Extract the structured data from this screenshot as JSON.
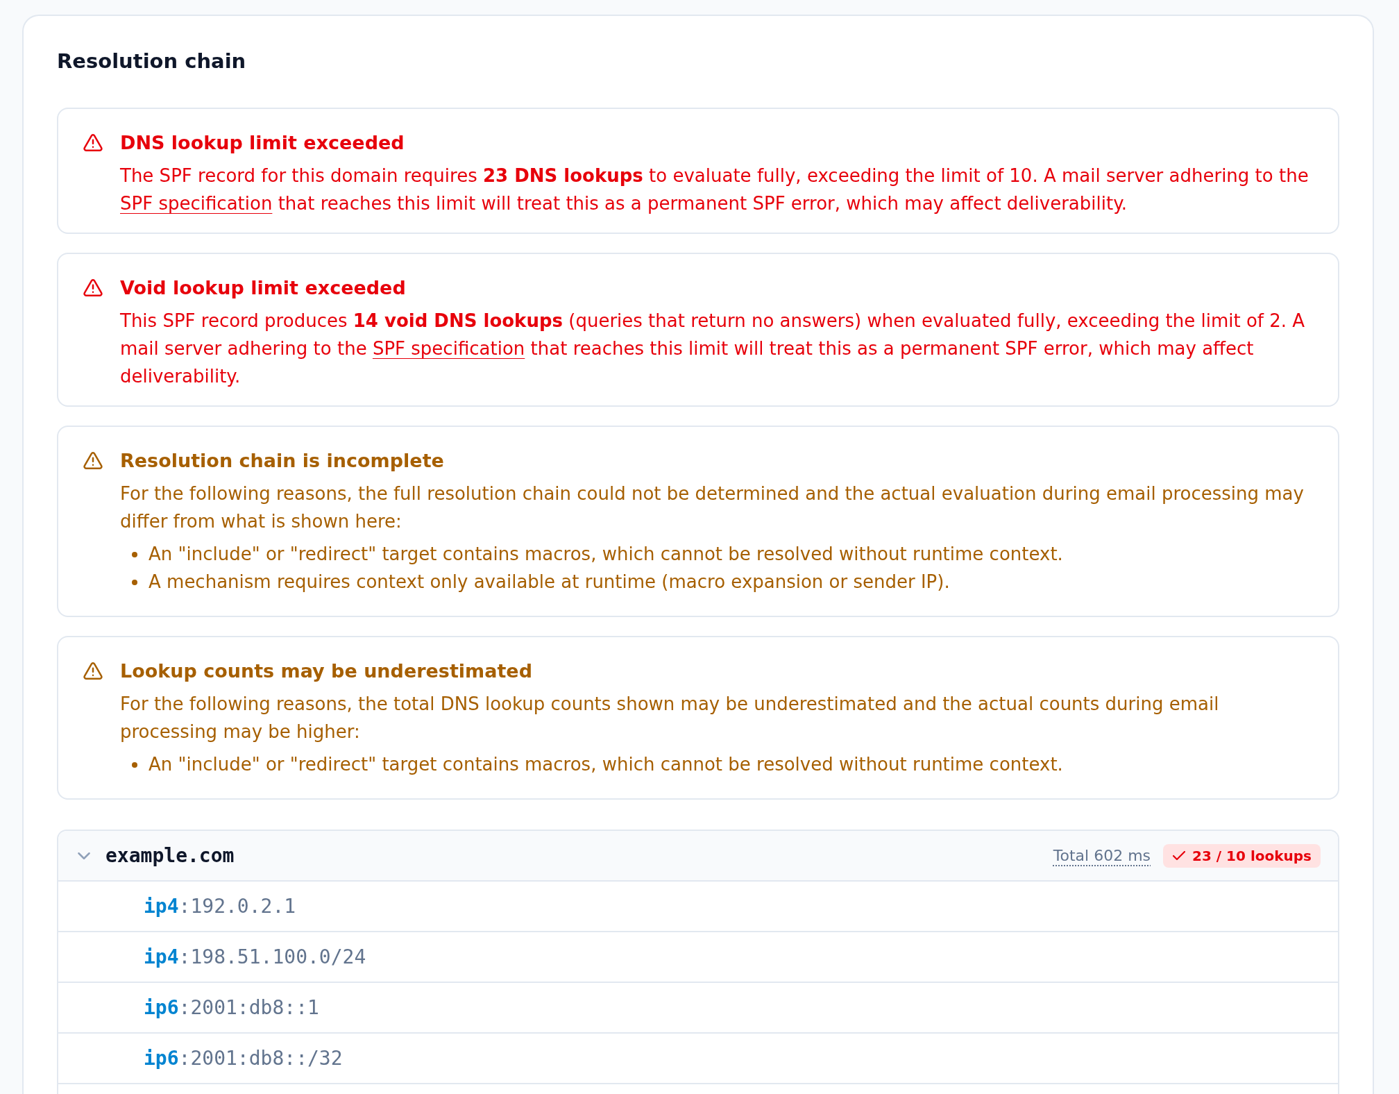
{
  "section": {
    "title": "Resolution chain"
  },
  "alerts": [
    {
      "kind": "error",
      "title": "DNS lookup limit exceeded",
      "message": [
        {
          "kind": "text",
          "text": "The SPF record for this domain requires **23 DNS lookups** to evaluate fully, exceeding the limit of 10. A mail server adhering to the "
        },
        {
          "kind": "link",
          "text": "SPF specification"
        },
        {
          "kind": "text",
          "text": " that reaches this limit will treat this as a permanent SPF error, which may affect deliverability."
        }
      ]
    },
    {
      "kind": "error",
      "title": "Void lookup limit exceeded",
      "message": [
        {
          "kind": "text",
          "text": "This SPF record produces **14 void DNS lookups** (queries that return no answers) when evaluated fully, exceeding the limit of 2. A mail server adhering to the "
        },
        {
          "kind": "link",
          "text": "SPF specification"
        },
        {
          "kind": "text",
          "text": " that reaches this limit will treat this as a permanent SPF error, which may affect deliverability."
        }
      ]
    },
    {
      "kind": "warning",
      "title": "Resolution chain is incomplete",
      "message": [
        {
          "kind": "text",
          "text": "For the following reasons, the full resolution chain could not be determined and the actual evaluation during email processing may differ from what is shown here:"
        }
      ],
      "reasons": [
        "An \"include\" or \"redirect\" target contains macros, which cannot be resolved without runtime context.",
        "A mechanism requires context only available at runtime (macro expansion or sender IP)."
      ]
    },
    {
      "kind": "warning",
      "title": "Lookup counts may be underestimated",
      "message": [
        {
          "kind": "text",
          "text": "For the following reasons, the total DNS lookup counts shown may be underestimated and the actual counts during email processing may be higher:"
        }
      ],
      "reasons": [
        "An \"include\" or \"redirect\" target contains macros, which cannot be resolved without runtime context."
      ]
    }
  ],
  "tree": {
    "domain": "example.com",
    "expanded": true,
    "total": "Total 602 ms",
    "lookups": {
      "text": "23 / 10 lookups",
      "over_limit": true
    },
    "children": [
      {
        "term": "**ip4**:192.0.2.1"
      },
      {
        "term": "**ip4**:198.51.100.0/24"
      },
      {
        "term": "**ip6**:2001:db8::1"
      },
      {
        "term": "**ip6**:2001:db8::/32"
      }
    ]
  }
}
